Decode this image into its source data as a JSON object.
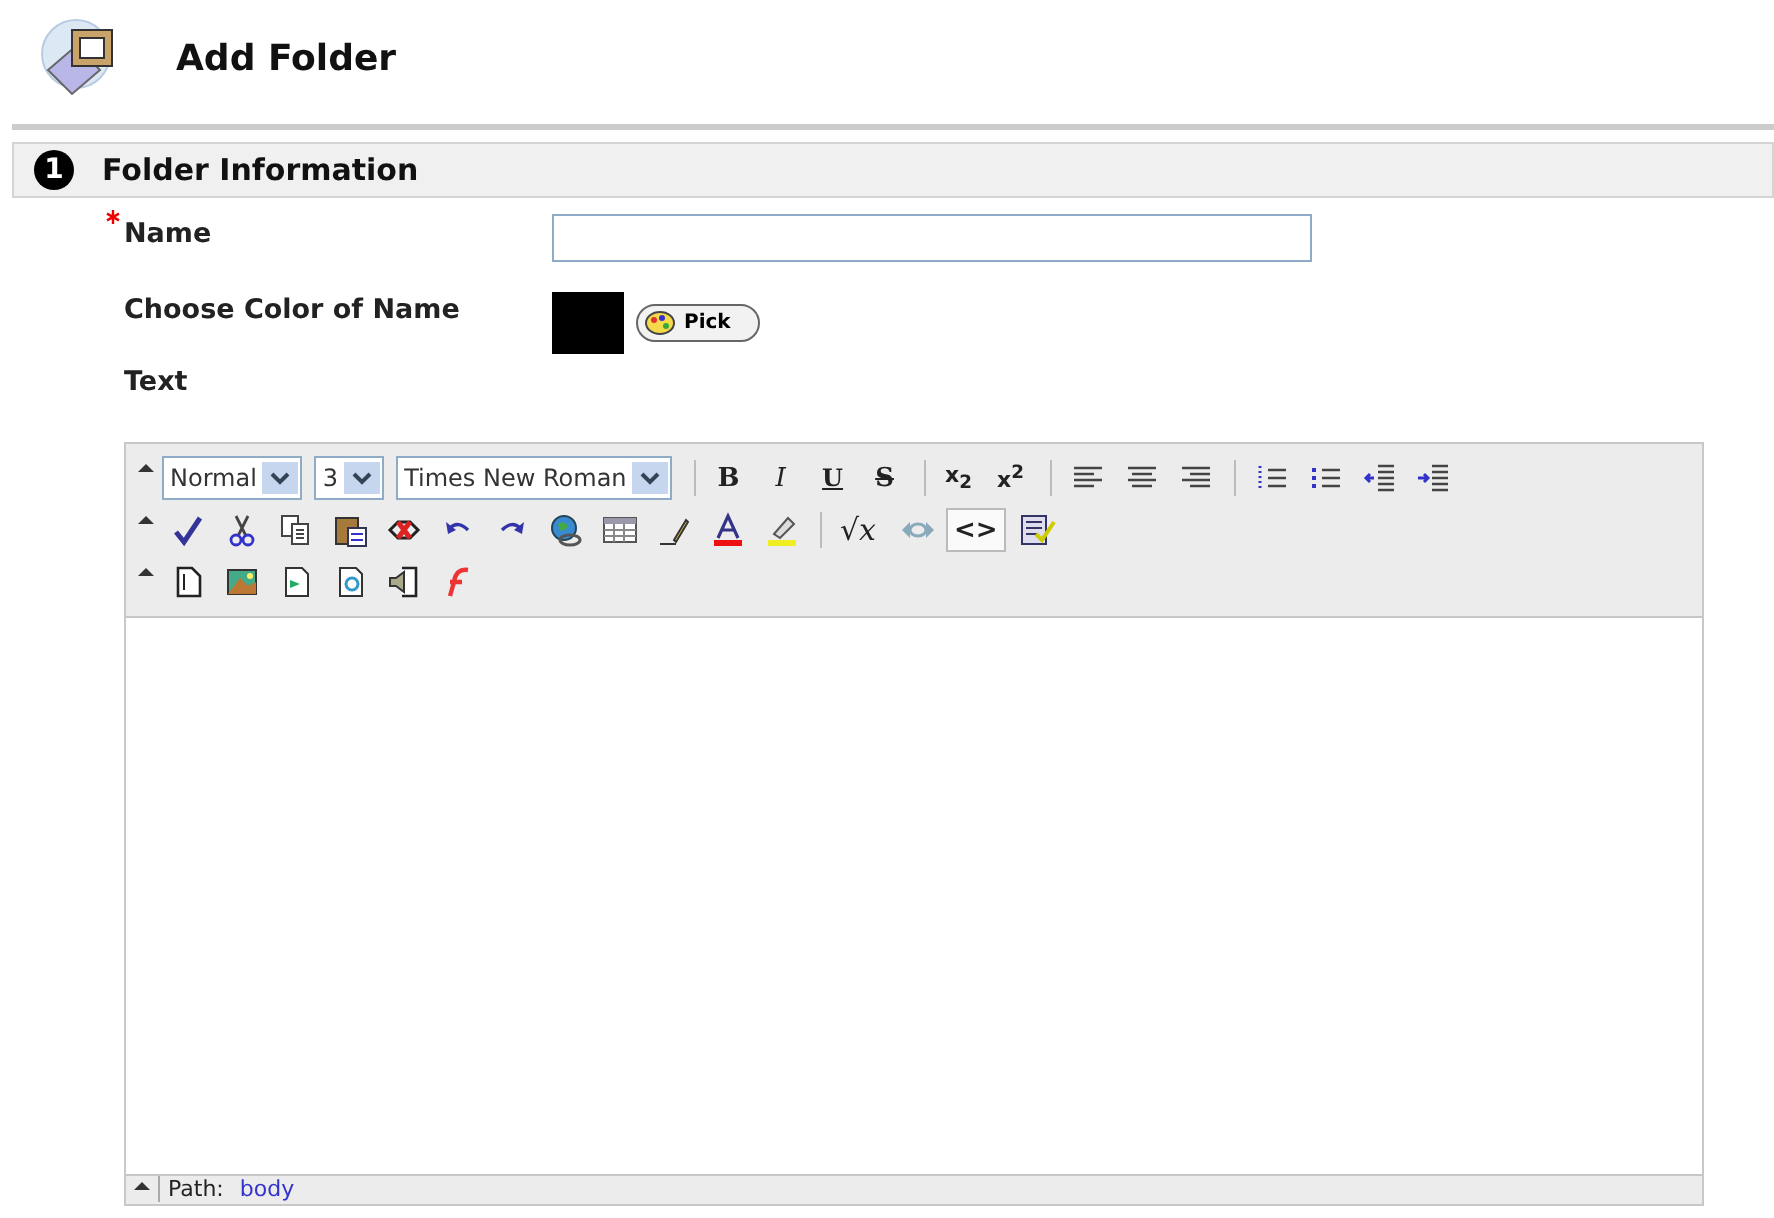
{
  "page": {
    "title": "Add Folder"
  },
  "section": {
    "number": "1",
    "title": "Folder Information"
  },
  "fields": [
    {
      "kind": "text",
      "label": "Name",
      "required": true
    },
    {
      "kind": "color",
      "label": "Choose Color of Name",
      "required": false,
      "color": "#000000",
      "button": "Pick"
    },
    {
      "kind": "heading",
      "label": "Text",
      "required": false
    }
  ],
  "toolbar": [
    [
      {
        "kind": "select",
        "value": "Normal"
      },
      {
        "kind": "select",
        "value": "3"
      },
      {
        "kind": "select",
        "value": "Times New Roman"
      },
      {
        "kind": "sep"
      },
      {
        "kind": "text",
        "label": "B",
        "pressed": false
      },
      {
        "kind": "text",
        "label": "I",
        "pressed": false
      },
      {
        "kind": "text",
        "label": "U",
        "pressed": false
      },
      {
        "kind": "text",
        "label": "S",
        "pressed": false
      },
      {
        "kind": "sep"
      },
      {
        "kind": "text",
        "label": "x$_{2}$",
        "pressed": false
      },
      {
        "kind": "text",
        "label": "x$^{2}$",
        "pressed": false
      },
      {
        "kind": "sep"
      },
      {
        "kind": "icon"
      },
      {
        "kind": "icon"
      },
      {
        "kind": "icon"
      },
      {
        "kind": "sep"
      },
      {
        "kind": "icon"
      },
      {
        "kind": "icon"
      },
      {
        "kind": "icon"
      },
      {
        "kind": "icon"
      }
    ],
    [
      {
        "kind": "icon"
      },
      {
        "kind": "icon"
      },
      {
        "kind": "icon"
      },
      {
        "kind": "icon"
      },
      {
        "kind": "icon"
      },
      {
        "kind": "icon"
      },
      {
        "kind": "icon"
      },
      {
        "kind": "icon"
      },
      {
        "kind": "icon"
      },
      {
        "kind": "icon"
      },
      {
        "kind": "icon"
      },
      {
        "kind": "icon"
      },
      {
        "kind": "sep"
      },
      {
        "kind": "text",
        "label": "√x",
        "pressed": false
      },
      {
        "kind": "icon"
      },
      {
        "kind": "text",
        "label": "<>",
        "pressed": true
      },
      {
        "kind": "icon"
      }
    ],
    [
      {
        "kind": "icon"
      },
      {
        "kind": "icon"
      },
      {
        "kind": "icon"
      },
      {
        "kind": "icon"
      },
      {
        "kind": "icon"
      },
      {
        "kind": "icon"
      }
    ]
  ],
  "path": {
    "label": "Path:",
    "value": "body"
  }
}
